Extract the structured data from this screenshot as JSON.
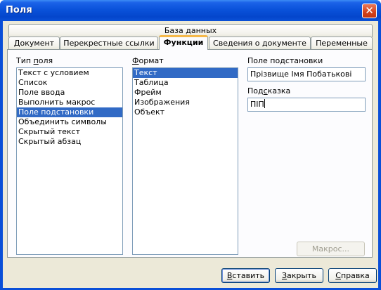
{
  "window": {
    "title": "Поля",
    "close_symbol": "✕"
  },
  "tabs": {
    "row_back": "База данных",
    "row_front": [
      "Документ",
      "Перекрестные ссылки",
      "Функции",
      "Сведения о документе",
      "Переменные"
    ],
    "active": "Функции"
  },
  "type_field": {
    "label_pre": "Тип ",
    "label_u": "п",
    "label_post": "оля",
    "items": [
      "Текст с условием",
      "Список",
      "Поле ввода",
      "Выполнить макрос",
      "Поле подстановки",
      "Объединить символы",
      "Скрытый текст",
      "Скрытый абзац"
    ],
    "selected": "Поле подстановки"
  },
  "format": {
    "label_u": "Ф",
    "label_post": "ормат",
    "items": [
      "Текст",
      "Таблица",
      "Фрейм",
      "Изображения",
      "Объект"
    ],
    "selected": "Текст"
  },
  "placeholder": {
    "label": "Поле подстановки",
    "value": "Прізвище Імя Побатькові"
  },
  "hint": {
    "label_pre": "Под",
    "label_u": "с",
    "label_post": "казка",
    "value": "ПІП"
  },
  "buttons": {
    "macro": "Макрос...",
    "insert_u": "В",
    "insert_post": "ставить",
    "close_u": "З",
    "close_post": "акрыть",
    "help_u": "С",
    "help_post": "правка"
  },
  "colors": {
    "selection": "#316ac5",
    "titlebar": "#0a52da",
    "face": "#ece9d8",
    "active_tab_accent": "#f5b84a"
  }
}
